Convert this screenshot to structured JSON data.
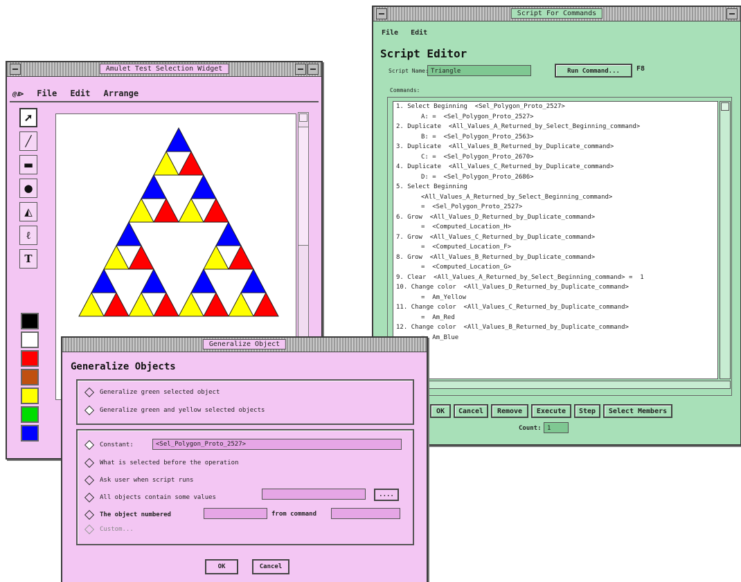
{
  "draw_window": {
    "title": "Amulet Test Selection Widget",
    "menu": [
      "File",
      "Edit",
      "Arrange"
    ],
    "menu_icon": "amulet-logo-icon",
    "tools": [
      {
        "name": "pointer-tool",
        "glyph": "➚"
      },
      {
        "name": "line-tool",
        "glyph": "╱"
      },
      {
        "name": "rectangle-tool",
        "glyph": "▬"
      },
      {
        "name": "circle-tool",
        "glyph": "●"
      },
      {
        "name": "polygon-tool",
        "glyph": "◭"
      },
      {
        "name": "freehand-tool",
        "glyph": "ℓ"
      },
      {
        "name": "text-tool",
        "glyph": "T"
      }
    ],
    "colors": [
      "#000000",
      "#ffffff",
      "#ff0000",
      "#c05010",
      "#ffff00",
      "#00dd00",
      "#0000ff"
    ],
    "triangle_colors": {
      "top": "#0000ff",
      "left": "#ffff00",
      "right": "#ff0000"
    }
  },
  "script_window": {
    "title": "Script For Commands",
    "menu": [
      "File",
      "Edit"
    ],
    "heading": "Script Editor",
    "script_name_label": "Script Name:",
    "script_name_value": "Triangle",
    "run_button": "Run Command...",
    "run_shortcut": "F8",
    "commands_label": "Commands:",
    "commands": [
      {
        "text": "1. Select Beginning  <Sel_Polygon_Proto_2527>",
        "sub": false
      },
      {
        "text": "A: =  <Sel_Polygon_Proto_2527>",
        "sub": true
      },
      {
        "text": "2. Duplicate  <All_Values_A_Returned_by_Select_Beginning_command>",
        "sub": false
      },
      {
        "text": "B: =  <Sel_Polygon_Proto_2563>",
        "sub": true
      },
      {
        "text": "3. Duplicate  <All_Values_B_Returned_by_Duplicate_command>",
        "sub": false
      },
      {
        "text": "C: =  <Sel_Polygon_Proto_2670>",
        "sub": true
      },
      {
        "text": "4. Duplicate  <All_Values_C_Returned_by_Duplicate_command>",
        "sub": false
      },
      {
        "text": "D: =  <Sel_Polygon_Proto_2686>",
        "sub": true
      },
      {
        "text": "5. Select Beginning",
        "sub": false
      },
      {
        "text": "<All_Values_A_Returned_by_Select_Beginning_command>",
        "sub": true
      },
      {
        "text": "=  <Sel_Polygon_Proto_2527>",
        "sub": true
      },
      {
        "text": "6. Grow  <All_Values_D_Returned_by_Duplicate_command>",
        "sub": false
      },
      {
        "text": "=  <Computed_Location_H>",
        "sub": true
      },
      {
        "text": "7. Grow  <All_Values_C_Returned_by_Duplicate_command>",
        "sub": false
      },
      {
        "text": "=  <Computed_Location_F>",
        "sub": true
      },
      {
        "text": "8. Grow  <All_Values_B_Returned_by_Duplicate_command>",
        "sub": false
      },
      {
        "text": "=  <Computed_Location_G>",
        "sub": true
      },
      {
        "text": "9. Clear  <All_Values_A_Returned_by_Select_Beginning_command> =  1",
        "sub": false
      },
      {
        "text": "10. Change color  <All_Values_D_Returned_by_Duplicate_command>",
        "sub": false
      },
      {
        "text": "=  Am_Yellow",
        "sub": true
      },
      {
        "text": "11. Change color  <All_Values_C_Returned_by_Duplicate_command>",
        "sub": false
      },
      {
        "text": "=  Am_Red",
        "sub": true
      },
      {
        "text": "12. Change color  <All_Values_B_Returned_by_Duplicate_command>",
        "sub": false
      },
      {
        "text": "=  Am_Blue",
        "sub": true
      }
    ],
    "buttons": [
      "OK",
      "Cancel",
      "Remove",
      "Execute",
      "Step",
      "Select Members"
    ],
    "count_label": "Count:",
    "count_value": "1"
  },
  "generalize_dialog": {
    "title": "Generalize Object",
    "heading": "Generalize Objects",
    "scope_options": [
      {
        "label": "Generalize green selected object",
        "selected": false
      },
      {
        "label": "Generalize green and yellow selected objects",
        "selected": true
      }
    ],
    "constant_label": "Constant:",
    "constant_value": "<Sel_Polygon_Proto_2527>",
    "value_options": [
      "What is selected before the operation",
      "Ask user when script runs",
      "All objects contain some values",
      "The object numbered"
    ],
    "from_label": "from command",
    "custom_label": "Custom...",
    "browse_label": "....",
    "ok": "OK",
    "cancel": "Cancel"
  }
}
